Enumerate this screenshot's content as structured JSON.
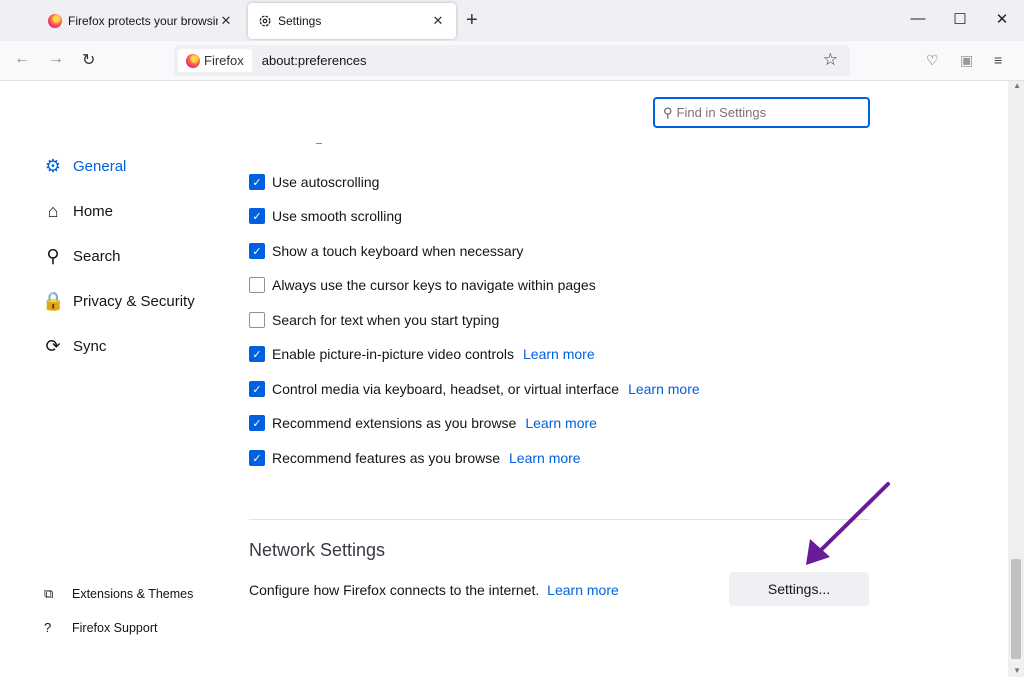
{
  "tabs": [
    {
      "title": "Firefox protects your browsing...",
      "icon": "firefox-icon",
      "close": "✕"
    },
    {
      "title": "Settings",
      "icon": "gear-icon",
      "close": "✕"
    }
  ],
  "new_tab": "+",
  "window_controls": {
    "minimize": "—",
    "maximize": "☐",
    "close": "✕"
  },
  "nav": {
    "back": "←",
    "forward": "→",
    "reload": "↻"
  },
  "urlbar": {
    "identity": "Firefox",
    "url": "about:preferences"
  },
  "search": {
    "placeholder": "Find in Settings"
  },
  "categories": [
    {
      "label": "General",
      "icon": "gear-icon",
      "glyph": "⚙"
    },
    {
      "label": "Home",
      "icon": "home-icon",
      "glyph": "⌂"
    },
    {
      "label": "Search",
      "icon": "search-icon",
      "glyph": "⚲"
    },
    {
      "label": "Privacy & Security",
      "icon": "lock-icon",
      "glyph": "🔒"
    },
    {
      "label": "Sync",
      "icon": "sync-icon",
      "glyph": "⟳"
    }
  ],
  "footer_links": [
    {
      "label": "Extensions & Themes",
      "icon": "puzzle-icon",
      "glyph": "⧉"
    },
    {
      "label": "Firefox Support",
      "icon": "help-icon",
      "glyph": "?"
    }
  ],
  "options": [
    {
      "label": "Use autoscrolling",
      "checked": true,
      "link": ""
    },
    {
      "label": "Use smooth scrolling",
      "checked": true,
      "link": ""
    },
    {
      "label": "Show a touch keyboard when necessary",
      "checked": true,
      "link": ""
    },
    {
      "label": "Always use the cursor keys to navigate within pages",
      "checked": false,
      "link": ""
    },
    {
      "label": "Search for text when you start typing",
      "checked": false,
      "link": ""
    },
    {
      "label": "Enable picture-in-picture video controls",
      "checked": true,
      "link": "Learn more"
    },
    {
      "label": "Control media via keyboard, headset, or virtual interface",
      "checked": true,
      "link": "Learn more"
    },
    {
      "label": "Recommend extensions as you browse",
      "checked": true,
      "link": "Learn more"
    },
    {
      "label": "Recommend features as you browse",
      "checked": true,
      "link": "Learn more"
    }
  ],
  "network": {
    "title": "Network Settings",
    "description": "Configure how Firefox connects to the internet.",
    "learn_more": "Learn more",
    "button": "Settings..."
  },
  "colors": {
    "accent": "#0061e0",
    "annotation_arrow": "#6a1b9a"
  }
}
